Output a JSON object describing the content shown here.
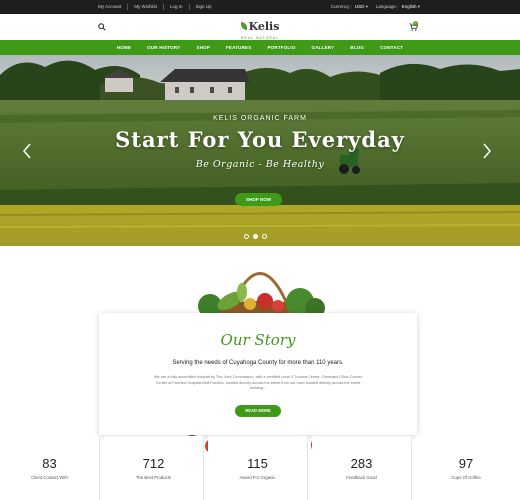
{
  "topbar": {
    "links": [
      "My Account",
      "My Wishlist",
      "Log In",
      "Sign Up"
    ],
    "currency_label": "Currency :",
    "currency_value": "USD",
    "language_label": "Language :",
    "language_value": "English"
  },
  "header": {
    "logo_name": "Kelis",
    "logo_tagline": "REAL NATURAL",
    "cart_count": "0"
  },
  "nav": {
    "items": [
      "HOME",
      "OUR HISTORY",
      "SHOP",
      "FEATURES",
      "PORTFOLIO",
      "GALLERY",
      "BLOG",
      "CONTACT"
    ]
  },
  "hero": {
    "subtitle": "KELIS ORGANIC FARM",
    "title": "Start For You Everyday",
    "tagline": "Be Organic - Be Healthy",
    "button": "SHOP NOW",
    "slides": 3,
    "active_slide": 1
  },
  "story": {
    "heading": "Our Story",
    "lead": "Serving the needs of Cuyahoga County for more than 110 years.",
    "body": "We are a fully accredited hospital by The Joint Commission, with a certified Level II Trauma Center, Cleveland Clinic Cancer Center at Fairview Hospital Moll Pavilion, located directly across the street from our main located directly across the street building...",
    "button": "READ MORE"
  },
  "counters": [
    {
      "value": "83",
      "label": "Client Contact With"
    },
    {
      "value": "712",
      "label": "The Best Products"
    },
    {
      "value": "115",
      "label": "Award For Organic"
    },
    {
      "value": "283",
      "label": "Feedback Good"
    },
    {
      "value": "97",
      "label": "Cups Of Coffee"
    }
  ],
  "colors": {
    "accent": "#3f9a18",
    "topbar": "#1e1e1e"
  },
  "icons": [
    "search-icon",
    "cart-icon",
    "leaf-logo-icon",
    "arrow-left-icon",
    "arrow-right-icon"
  ]
}
